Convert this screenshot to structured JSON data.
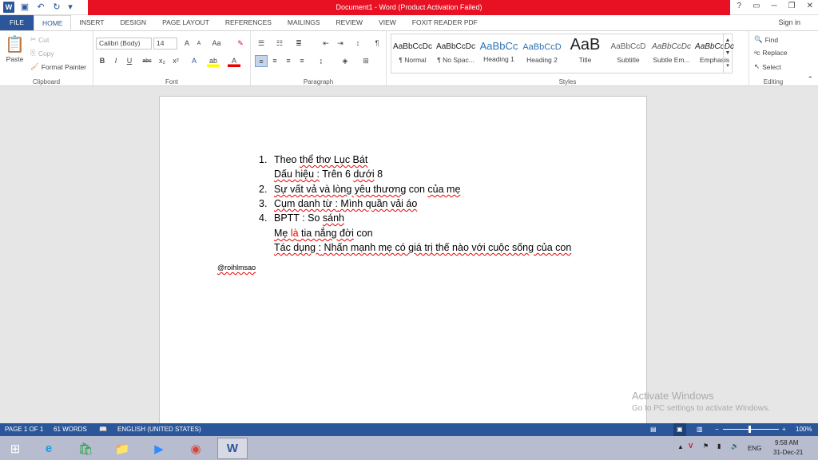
{
  "window": {
    "title": "Document1 - Word (Product Activation Failed)",
    "help": "?",
    "minimize": "─",
    "restore": "❐",
    "close": "✕"
  },
  "qat": {
    "save": "💾",
    "undo": "↶",
    "redo": "↻",
    "customize": "▾"
  },
  "tabs": [
    "FILE",
    "HOME",
    "INSERT",
    "DESIGN",
    "PAGE LAYOUT",
    "REFERENCES",
    "MAILINGS",
    "REVIEW",
    "VIEW",
    "FOXIT READER PDF"
  ],
  "account": {
    "signin": "Sign in"
  },
  "clipboard": {
    "paste": "Paste",
    "cut": "Cut",
    "copy": "Copy",
    "format_painter": "Format Painter",
    "label": "Clipboard"
  },
  "font": {
    "name": "Calibri (Body)",
    "size": "14",
    "label": "Font",
    "bold": "B",
    "italic": "I",
    "underline": "U",
    "strike": "abc",
    "subscript": "x₂",
    "superscript": "x²",
    "grow": "A",
    "shrink": "A",
    "case": "Aa",
    "clear": "✎",
    "effects": "A",
    "highlight": "ab",
    "color": "A"
  },
  "paragraph": {
    "label": "Paragraph"
  },
  "styles": {
    "label": "Styles",
    "items": [
      {
        "sample": "AaBbCcDc",
        "name": "¶ Normal"
      },
      {
        "sample": "AaBbCcDc",
        "name": "¶ No Spac..."
      },
      {
        "sample": "AaBbCc",
        "name": "Heading 1"
      },
      {
        "sample": "AaBbCcD",
        "name": "Heading 2"
      },
      {
        "sample": "AaB",
        "name": "Title"
      },
      {
        "sample": "AaBbCcD",
        "name": "Subtitle"
      },
      {
        "sample": "AaBbCcDc",
        "name": "Subtle Em..."
      },
      {
        "sample": "AaBbCcDc",
        "name": "Emphasis"
      }
    ]
  },
  "editing": {
    "find": "Find",
    "replace": "Replace",
    "select": "Select",
    "label": "Editing"
  },
  "document": {
    "n1": "1.",
    "l1a": "Theo ",
    "l1b": "thể thơ Lục Bát",
    "l2a": "Dấu hiệu :",
    "l2b": " Trên 6 ",
    "l2c": "dưới",
    " l2d": " 8",
    "n2": "2.",
    "l3a": "Sự vất vả và lòng yêu thương",
    "l3b": " con ",
    "l3c": "của mẹ",
    "n3": "3.",
    "l4a": "Cụm danh từ :",
    "l4b": " Mình quần vải áo",
    "n4": "4.",
    "l5a": "BPTT : So ",
    "l5b": "sánh",
    "l6a": "Mẹ ",
    "l6b": "là",
    "l6c": " tia nắng đời",
    " l6d": " con",
    "l7a": "Tác dụng :",
    "l7b": " Nhấn mạnh mẹ có giá trị thế nào với cuộc sống của con",
    "signature": "@roihlmsao"
  },
  "watermark": {
    "line1": "Activate Windows",
    "line2": "Go to PC settings to activate Windows."
  },
  "status": {
    "page": "PAGE 1 OF 1",
    "words": "61 WORDS",
    "lang": "ENGLISH (UNITED STATES)",
    "zoom": "100%"
  },
  "tray": {
    "lang": "ENG",
    "time": "9:58 AM",
    "date": "31-Dec-21"
  }
}
